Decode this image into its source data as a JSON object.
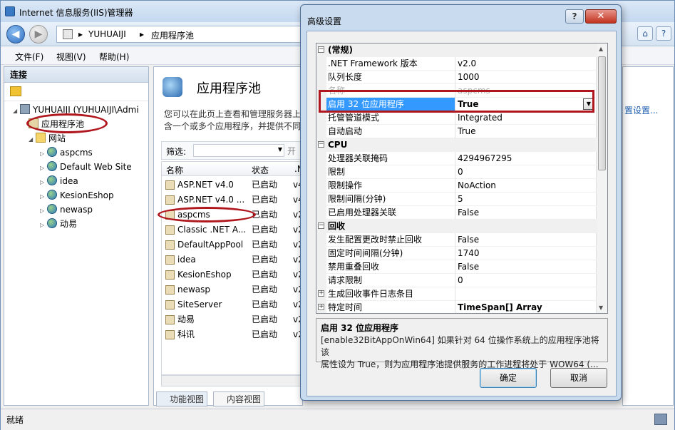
{
  "main": {
    "title": "Internet 信息服务(IIS)管理器",
    "breadcrumb": [
      "YUHUAIJI",
      "应用程序池"
    ],
    "menu": [
      "文件(F)",
      "视图(V)",
      "帮助(H)"
    ],
    "status": "就绪"
  },
  "connections": {
    "header": "连接",
    "server": "YUHUAIJI (YUHUAIJI\\Admi",
    "app_pools": "应用程序池",
    "sites": "网站",
    "site_list": [
      "aspcms",
      "Default Web Site",
      "idea",
      "KesionEshop",
      "newasp",
      "动易"
    ]
  },
  "content": {
    "page_title": "应用程序池",
    "desc_line1": "您可以在此页上查看和管理服务器上的",
    "desc_line2": "含一个或多个应用程序，并提供不同",
    "filter_label": "筛选:",
    "go_label": "开",
    "columns": [
      "名称",
      "状态",
      ".N"
    ],
    "rows": [
      {
        "name": "ASP.NET v4.0",
        "status": "已启动",
        "ver": "v4"
      },
      {
        "name": "ASP.NET v4.0 ...",
        "status": "已启动",
        "ver": "v4"
      },
      {
        "name": "aspcms",
        "status": "已启动",
        "ver": "v2"
      },
      {
        "name": "Classic .NET A...",
        "status": "已启动",
        "ver": "v2"
      },
      {
        "name": "DefaultAppPool",
        "status": "已启动",
        "ver": "v2"
      },
      {
        "name": "idea",
        "status": "已启动",
        "ver": "v2"
      },
      {
        "name": "KesionEshop",
        "status": "已启动",
        "ver": "v2"
      },
      {
        "name": "newasp",
        "status": "已启动",
        "ver": "v2"
      },
      {
        "name": "SiteServer",
        "status": "已启动",
        "ver": "v2"
      },
      {
        "name": "动易",
        "status": "已启动",
        "ver": "v2"
      },
      {
        "name": "科讯",
        "status": "已启动",
        "ver": "v2"
      }
    ],
    "tab_features": "功能视图",
    "tab_content": "内容视图"
  },
  "actions": {
    "link": "置设置..."
  },
  "dialog": {
    "title": "高级设置",
    "help_btn": "?",
    "close_btn": "✕",
    "grid": [
      {
        "kind": "cat",
        "name": "(常规)"
      },
      {
        "kind": "prop",
        "name": ".NET Framework 版本",
        "value": "v2.0"
      },
      {
        "kind": "prop",
        "name": "队列长度",
        "value": "1000"
      },
      {
        "kind": "dim",
        "name": "名称",
        "value": "aspcms"
      },
      {
        "kind": "sel",
        "name": "启用 32 位应用程序",
        "value": "True"
      },
      {
        "kind": "prop",
        "name": "托管管道模式",
        "value": "Integrated"
      },
      {
        "kind": "prop",
        "name": "自动启动",
        "value": "True"
      },
      {
        "kind": "cat",
        "name": "CPU"
      },
      {
        "kind": "prop",
        "name": "处理器关联掩码",
        "value": "4294967295"
      },
      {
        "kind": "prop",
        "name": "限制",
        "value": "0"
      },
      {
        "kind": "prop",
        "name": "限制操作",
        "value": "NoAction"
      },
      {
        "kind": "prop",
        "name": "限制间隔(分钟)",
        "value": "5"
      },
      {
        "kind": "prop",
        "name": "已启用处理器关联",
        "value": "False"
      },
      {
        "kind": "cat",
        "name": "回收"
      },
      {
        "kind": "prop",
        "name": "发生配置更改时禁止回收",
        "value": "False"
      },
      {
        "kind": "prop",
        "name": "固定时间间隔(分钟)",
        "value": "1740"
      },
      {
        "kind": "prop",
        "name": "禁用重叠回收",
        "value": "False"
      },
      {
        "kind": "prop",
        "name": "请求限制",
        "value": "0"
      },
      {
        "kind": "expand",
        "name": "生成回收事件日志条目",
        "value": ""
      },
      {
        "kind": "expand",
        "name": "特定时间",
        "value": "TimeSpan[] Array"
      }
    ],
    "desc_title": "启用 32 位应用程序",
    "desc_line1": "[enable32BitAppOnWin64] 如果针对 64 位操作系统上的应用程序池将该",
    "desc_line2": "属性设为 True，则为应用程序池提供服务的工作进程将处于 WOW64 (...",
    "ok": "确定",
    "cancel": "取消"
  }
}
